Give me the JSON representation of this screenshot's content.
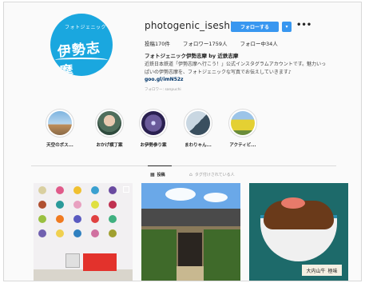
{
  "profile": {
    "username": "photogenic_iseshima",
    "avatar_arc_text": "フォトジェニック",
    "avatar_logo_text": "伊勢志摩",
    "follow_label": "フォローする",
    "dropdown_icon": "chevron-down-icon",
    "more_icon": "ellipsis-icon"
  },
  "stats": {
    "posts": "投稿170件",
    "followers": "フォロワー1759人",
    "following": "フォロー中34人"
  },
  "bio": {
    "name": "フォトジェニック伊勢志摩 by 近鉄志摩",
    "line1": "近鉄日本鉄道「伊勢志摩へ行こう！」公式インスタグラムアカウントです。魅力いっ",
    "line2": "ぱいの伊勢志摩を、フォトジェニックな写真でお伝えしていきます♪",
    "link": "goo.gl/imN52z",
    "followed_by": "フォロワー: sanpuchi"
  },
  "highlights": [
    {
      "label": "天空のポス..."
    },
    {
      "label": "おかげ横丁案"
    },
    {
      "label": "お伊勢参り案"
    },
    {
      "label": "まわりゃん..."
    },
    {
      "label": "アクティビ..."
    }
  ],
  "tabs": {
    "posts_label": "投稿",
    "posts_icon": "grid-icon",
    "tagged_label": "タグ付けされている人",
    "tagged_icon": "tag-icon"
  },
  "posts": [
    {
      "icon": "carousel-icon"
    },
    {
      "sign_text": ""
    },
    {
      "sign_text_a": "大内山牛",
      "sign_text_b": "極味"
    }
  ],
  "colors": {
    "brand_blue": "#1aa7df",
    "follow_button": "#3897f0",
    "link": "#003569"
  }
}
